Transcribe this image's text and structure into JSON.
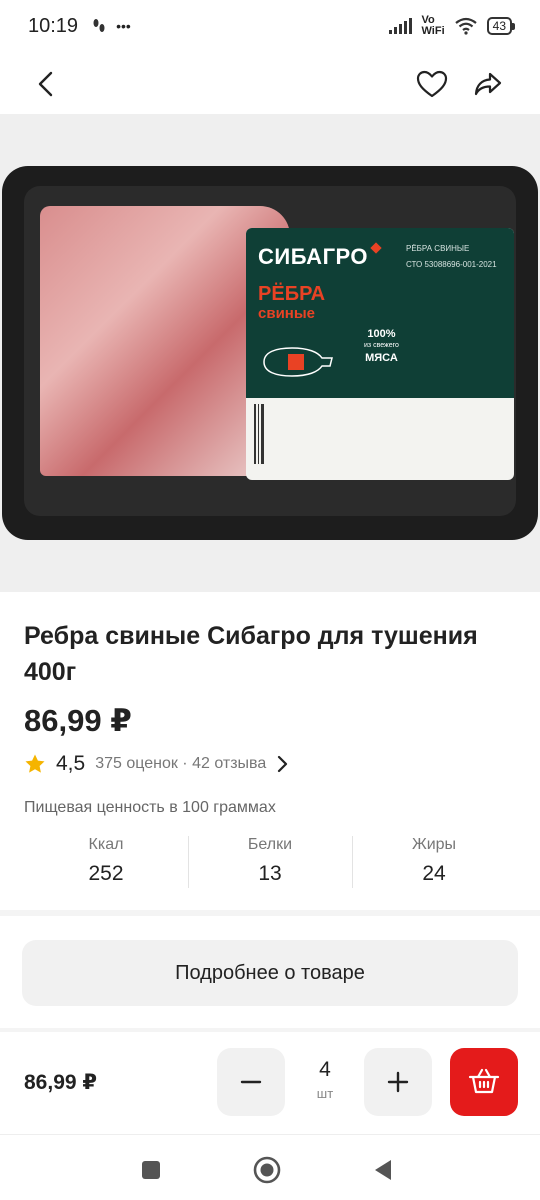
{
  "status_bar": {
    "time": "10:19",
    "vowifi_line1": "Vo",
    "vowifi_line2": "WiFi",
    "battery": "43"
  },
  "product_image": {
    "label_brand": "СИБАГРО",
    "label_product_line1": "РЁБРА",
    "label_product_line2": "свиные",
    "label_title_small": "РЁБРА СВИНЫЕ",
    "label_standard": "СТО 53088696-001-2021",
    "label_percent": "100%",
    "label_percent_sub": "из свежего",
    "label_meat": "МЯСА"
  },
  "product": {
    "title": "Ребра свиные Сибагро для тушения 400г",
    "price": "86,99 ₽",
    "rating_value": "4,5",
    "rating_meta": "375 оценок · 42 отзыва"
  },
  "nutrition": {
    "title": "Пищевая ценность в 100 граммах",
    "items": [
      {
        "label": "Ккал",
        "value": "252"
      },
      {
        "label": "Белки",
        "value": "13"
      },
      {
        "label": "Жиры",
        "value": "24"
      }
    ]
  },
  "details_button": "Подробнее о товаре",
  "buy_bar": {
    "price": "86,99 ₽",
    "quantity": "4",
    "unit": "шт"
  },
  "colors": {
    "accent_red": "#e41b1b",
    "star": "#f5b400",
    "label_green": "#0f3f36"
  }
}
